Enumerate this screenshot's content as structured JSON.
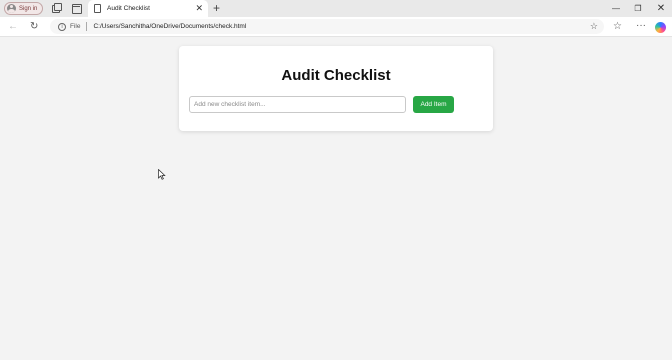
{
  "browser": {
    "sign_in_label": "Sign in",
    "tab_title": "Audit Checklist",
    "address_scheme": "File",
    "address_url": "C:/Users/Sanchitha/OneDrive/Documents/check.html"
  },
  "icons": {
    "profile": "person-icon",
    "workspaces": "workspaces-icon",
    "tab_actions": "tab-actions-icon",
    "new_tab": "plus-icon",
    "back": "arrow-left-icon",
    "reload": "reload-icon",
    "info": "info-icon",
    "favorite": "star-icon",
    "favorites_hub": "favorites-icon",
    "more": "more-icon",
    "copilot": "copilot-icon"
  },
  "page": {
    "heading": "Audit Checklist",
    "input_placeholder": "Add new checklist item...",
    "input_value": "",
    "add_button_label": "Add Item"
  },
  "colors": {
    "accent_button": "#28a745",
    "page_background": "#f3f3f3",
    "card_background": "#ffffff"
  }
}
